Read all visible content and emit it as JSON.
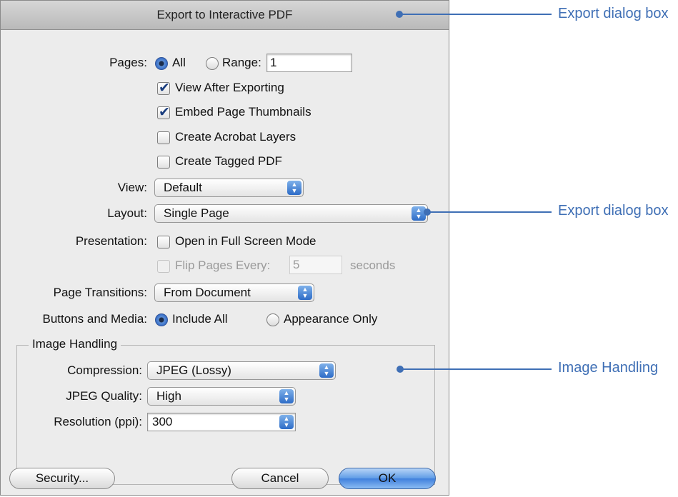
{
  "dialog": {
    "title": "Export to Interactive PDF",
    "pages_label": "Pages:",
    "pages_all": "All",
    "pages_range": "Range:",
    "range_value": "1",
    "view_after_exporting": "View After Exporting",
    "embed_page_thumbnails": "Embed Page Thumbnails",
    "create_acrobat_layers": "Create Acrobat Layers",
    "create_tagged_pdf": "Create Tagged PDF",
    "view_label": "View:",
    "view_value": "Default",
    "layout_label": "Layout:",
    "layout_value": "Single Page",
    "presentation_label": "Presentation:",
    "open_full_screen": "Open in Full Screen Mode",
    "flip_pages_every": "Flip Pages Every:",
    "flip_seconds_value": "5",
    "seconds": "seconds",
    "page_transitions_label": "Page Transitions:",
    "page_transitions_value": "From Document",
    "buttons_media_label": "Buttons and Media:",
    "include_all": "Include All",
    "appearance_only": "Appearance Only",
    "image_handling_title": "Image Handling",
    "compression_label": "Compression:",
    "compression_value": "JPEG (Lossy)",
    "jpeg_quality_label": "JPEG Quality:",
    "jpeg_quality_value": "High",
    "resolution_label": "Resolution (ppi):",
    "resolution_value": "300",
    "security_button": "Security...",
    "cancel_button": "Cancel",
    "ok_button": "OK"
  },
  "annotations": [
    "Export dialog box",
    "Export dialog box",
    "Image Handling"
  ],
  "colors": {
    "annotation": "#3f6fb5",
    "dialog_bg": "#ececec"
  }
}
